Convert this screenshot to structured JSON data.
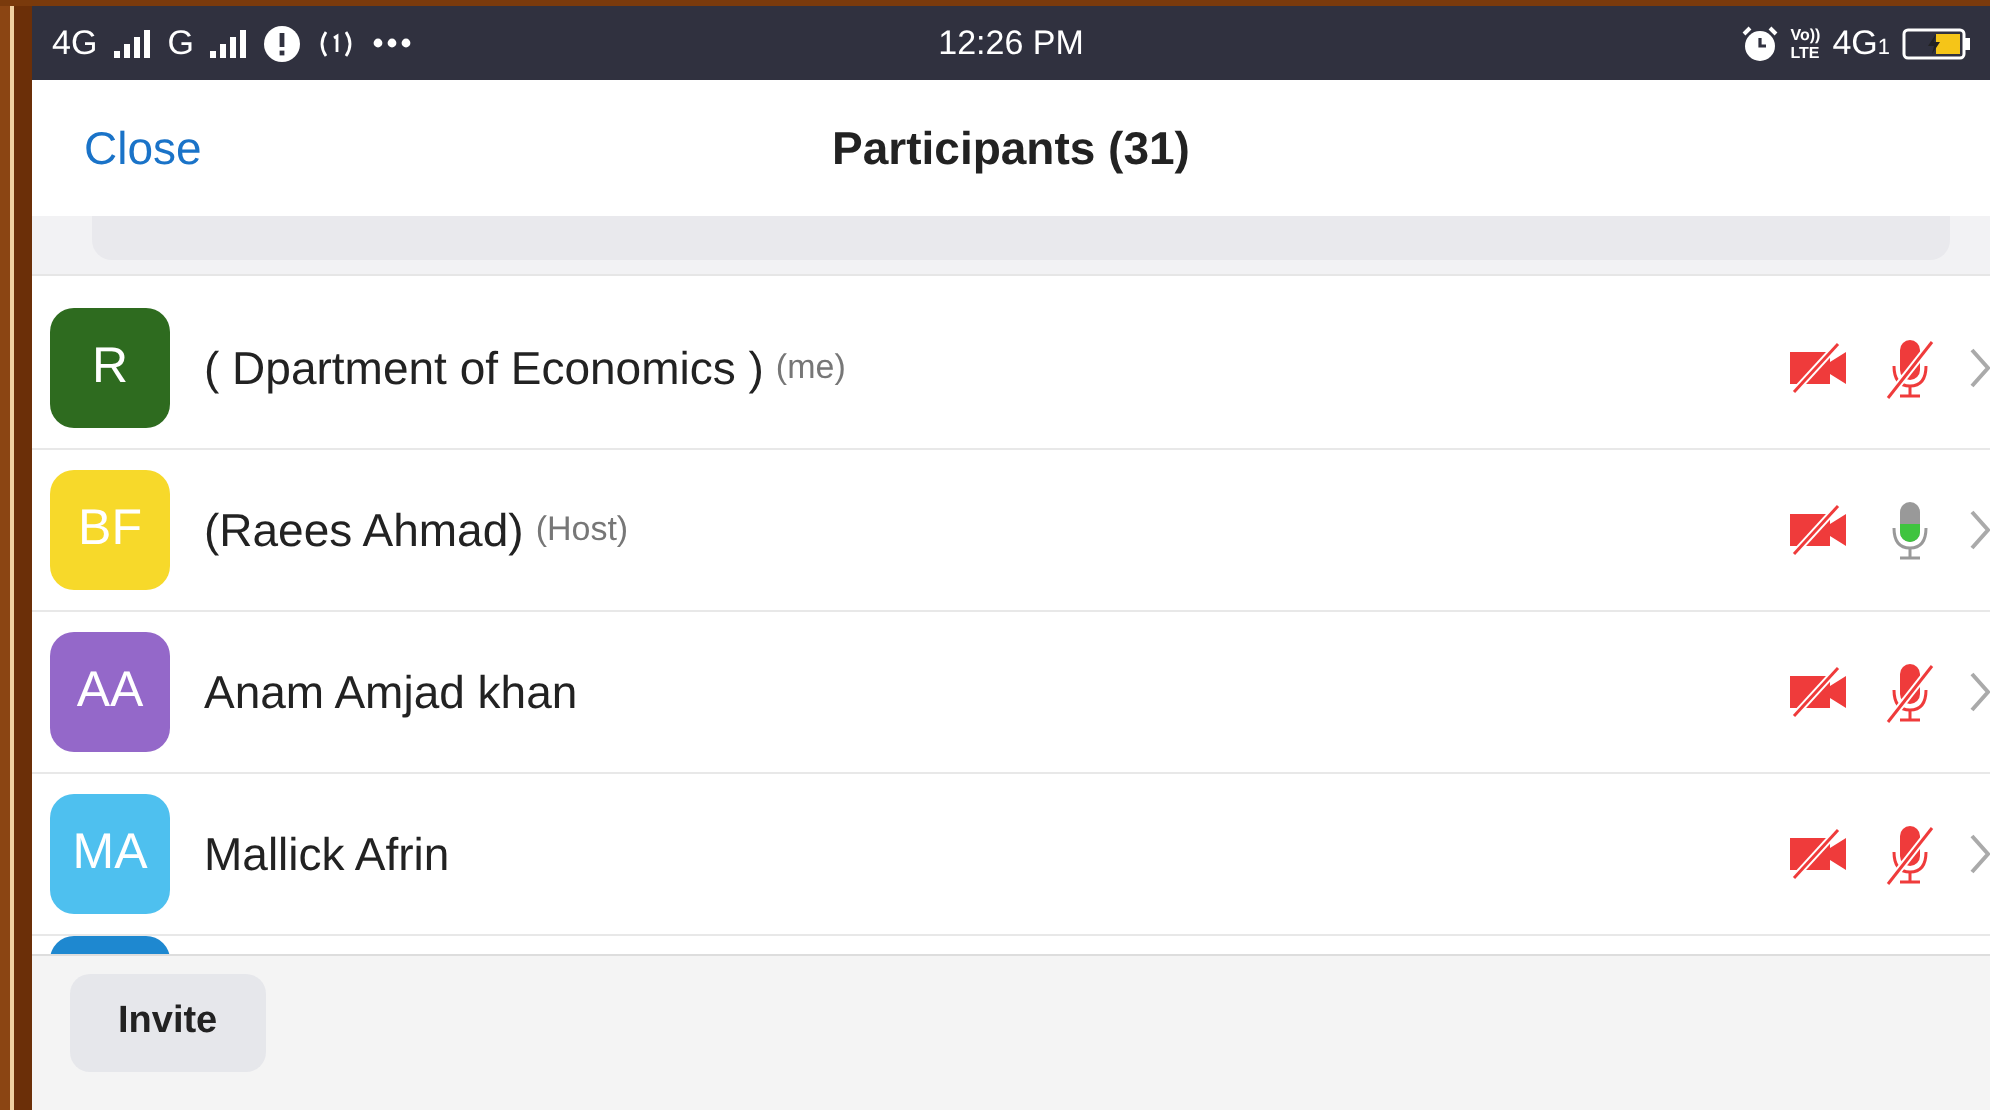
{
  "status_bar": {
    "left": [
      {
        "kind": "network",
        "text": "4G"
      },
      {
        "kind": "network",
        "text": "G"
      },
      {
        "kind": "alert"
      },
      {
        "kind": "hotspot"
      },
      {
        "kind": "more"
      }
    ],
    "time": "12:26 PM",
    "volte_top": "Vo))",
    "volte_bottom": "LTE",
    "network": "4G",
    "sim": "1"
  },
  "header": {
    "close": "Close",
    "title": "Participants (31)"
  },
  "participants": [
    {
      "initials": "R",
      "color": "#2e6b1f",
      "name": "( Dpartment of Economics )",
      "role": "(me)",
      "video_off": true,
      "muted": true
    },
    {
      "initials": "BF",
      "color": "#f7d92a",
      "name": "(Raees Ahmad)",
      "role": "(Host)",
      "video_off": true,
      "muted": false
    },
    {
      "initials": "AA",
      "color": "#9468c9",
      "name": "Anam Amjad khan",
      "video_off": true,
      "muted": true
    },
    {
      "initials": "MA",
      "color": "#4ec0ef",
      "name": "Mallick Afrin",
      "video_off": true,
      "muted": true
    }
  ],
  "partial_row": {
    "color": "#1e88d0"
  },
  "footer": {
    "invite": "Invite"
  }
}
